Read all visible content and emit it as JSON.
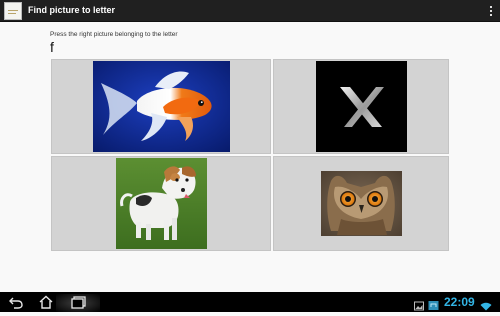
{
  "app": {
    "title": "Find picture to letter",
    "icon": "app-list-icon",
    "menu_icon": "overflow-menu-icon"
  },
  "quiz": {
    "instruction": "Press the right picture belonging to the letter",
    "letter": "f",
    "options": [
      {
        "subject": "goldfish",
        "icon": "goldfish-picture"
      },
      {
        "subject": "x",
        "icon": "letter-x-picture"
      },
      {
        "subject": "dog",
        "icon": "dog-picture"
      },
      {
        "subject": "owl",
        "icon": "owl-picture"
      }
    ]
  },
  "system_bar": {
    "clock": "22:09",
    "icons": [
      "back-icon",
      "home-icon",
      "recent-apps-icon",
      "gallery-notification-icon",
      "store-notification-icon",
      "wifi-icon"
    ],
    "accent": "#33b5e5"
  }
}
